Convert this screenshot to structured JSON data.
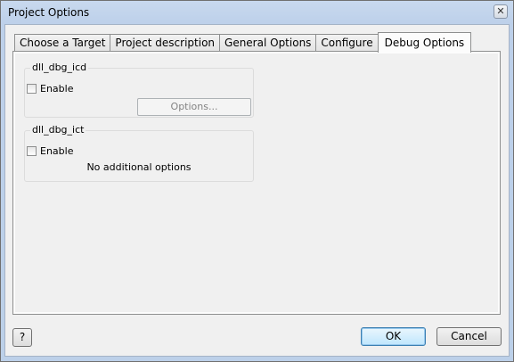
{
  "window": {
    "title": "Project Options",
    "close_glyph": "✕"
  },
  "tabs": [
    {
      "label": "Choose a Target"
    },
    {
      "label": "Project description"
    },
    {
      "label": "General Options"
    },
    {
      "label": "Configure"
    },
    {
      "label": "Debug Options",
      "active": true
    }
  ],
  "groups": [
    {
      "label": "dll_dbg_icd",
      "checkbox_label": "Enable",
      "checked": false,
      "options_button": "Options..."
    },
    {
      "label": "dll_dbg_ict",
      "checkbox_label": "Enable",
      "checked": false,
      "note": "No additional options"
    }
  ],
  "footer": {
    "help_label": "?",
    "ok_label": "OK",
    "cancel_label": "Cancel"
  },
  "icons": {
    "close": "close-icon"
  }
}
